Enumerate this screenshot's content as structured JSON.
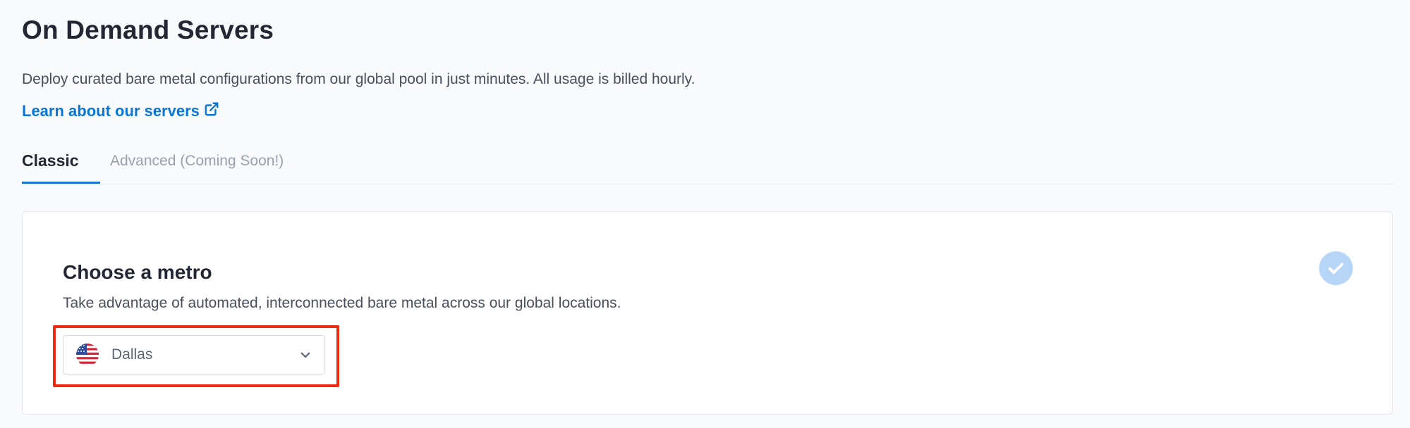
{
  "header": {
    "title": "On Demand Servers",
    "description": "Deploy curated bare metal configurations from our global pool in just minutes. All usage is billed hourly.",
    "learn_link_label": "Learn about our servers"
  },
  "tabs": [
    {
      "label": "Classic",
      "active": true
    },
    {
      "label": "Advanced (Coming Soon!)",
      "active": false
    }
  ],
  "metro_section": {
    "title": "Choose a metro",
    "subtitle": "Take advantage of automated, interconnected bare metal across our global locations.",
    "selected_metro": "Dallas",
    "selected_flag_icon": "us-flag-icon",
    "completed_icon": "check-icon"
  },
  "colors": {
    "link": "#0a77d6",
    "active_tab_underline": "#1b78cc",
    "check_badge": "#b7d6f7",
    "highlight": "#ee2a12"
  }
}
